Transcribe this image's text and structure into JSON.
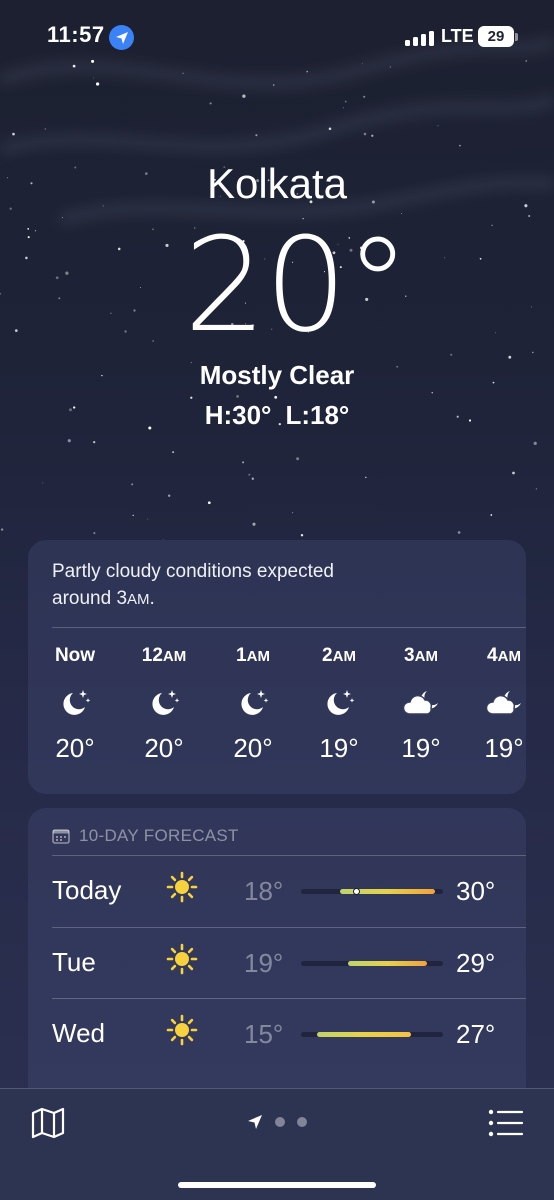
{
  "status_bar": {
    "time": "11:57",
    "network": "LTE",
    "battery": "29"
  },
  "current": {
    "city": "Kolkata",
    "temperature": "20°",
    "condition": "Mostly Clear",
    "high": "H:30°",
    "low": "L:18°"
  },
  "hourly": {
    "summary": "Partly cloudy conditions expected around 3AM.",
    "summary_parts": [
      "Partly cloudy conditions expected",
      "around 3",
      "AM",
      "."
    ],
    "hours": [
      {
        "label": "Now",
        "suffix": "",
        "icon": "moon-stars-icon",
        "temp": "20°"
      },
      {
        "label": "12",
        "suffix": "AM",
        "icon": "moon-stars-icon",
        "temp": "20°"
      },
      {
        "label": "1",
        "suffix": "AM",
        "icon": "moon-stars-icon",
        "temp": "20°"
      },
      {
        "label": "2",
        "suffix": "AM",
        "icon": "moon-stars-icon",
        "temp": "19°"
      },
      {
        "label": "3",
        "suffix": "AM",
        "icon": "cloud-moon-icon",
        "temp": "19°"
      },
      {
        "label": "4",
        "suffix": "AM",
        "icon": "cloud-moon-icon",
        "temp": "19°"
      }
    ]
  },
  "forecast": {
    "header": "10-DAY FORECAST",
    "days": [
      {
        "name": "Today",
        "icon": "sun-icon",
        "low": "18°",
        "high": "30°",
        "range": [
          18,
          30
        ],
        "current": 20
      },
      {
        "name": "Tue",
        "icon": "sun-icon",
        "low": "19°",
        "high": "29°",
        "range": [
          19,
          29
        ]
      },
      {
        "name": "Wed",
        "icon": "sun-icon",
        "low": "15°",
        "high": "27°",
        "range": [
          15,
          27
        ]
      }
    ],
    "scale": [
      13,
      31
    ]
  },
  "bottom_bar": {
    "icons": [
      "map-icon",
      "location-arrow-icon",
      "list-icon"
    ],
    "page_count": 3,
    "active_page": 0
  }
}
